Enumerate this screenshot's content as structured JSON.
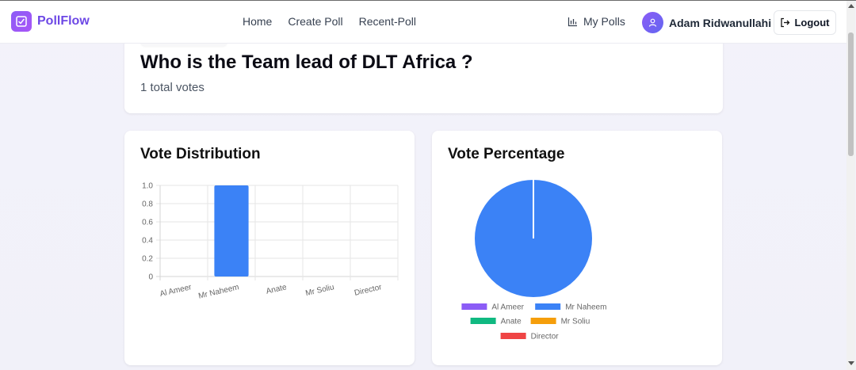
{
  "app": {
    "brand": "PollFlow"
  },
  "nav": {
    "links": [
      "Home",
      "Create Poll",
      "Recent-Poll"
    ],
    "my_polls": "My Polls",
    "user_name": "Adam Ridwanullahi",
    "logout": "Logout"
  },
  "poll": {
    "question": "Who is the Team lead of DLT Africa ?",
    "total_votes": "1 total votes"
  },
  "bar_card": {
    "title": "Vote Distribution"
  },
  "pie_card": {
    "title": "Vote Percentage"
  },
  "chart_data": [
    {
      "type": "bar",
      "title": "Vote Distribution",
      "categories": [
        "Al Ameer",
        "Mr Naheem",
        "Anate",
        "Mr Soliu",
        "Director"
      ],
      "values": [
        0,
        1,
        0,
        0,
        0
      ],
      "ylim": [
        0,
        1.0
      ],
      "yticks": [
        "0",
        "0.2",
        "0.4",
        "0.6",
        "0.8",
        "1.0"
      ],
      "grid": true,
      "bar_color": "#3b82f6"
    },
    {
      "type": "pie",
      "title": "Vote Percentage",
      "labels": [
        "Al Ameer",
        "Mr Naheem",
        "Anate",
        "Mr Soliu",
        "Director"
      ],
      "values": [
        0,
        1,
        0,
        0,
        0
      ],
      "colors": [
        "#8b5cf6",
        "#3b82f6",
        "#10b981",
        "#f59e0b",
        "#ef4444"
      ],
      "legend_position": "bottom"
    }
  ]
}
